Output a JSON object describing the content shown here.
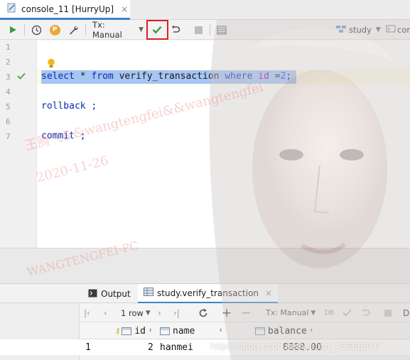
{
  "tab": {
    "title": "console_11 [HurryUp]",
    "close_icon": "×"
  },
  "toolbar": {
    "tx_mode": "Tx: Manual",
    "schema": "study",
    "console": "con",
    "p_badge": "P"
  },
  "editor": {
    "line_numbers": [
      "1",
      "2",
      "3",
      "4",
      "5",
      "6",
      "7"
    ],
    "line3": {
      "kw_select": "select",
      "star": " * ",
      "kw_from": "from",
      "table": " verify_transaction ",
      "kw_where": "where",
      "sp": " ",
      "col": "id",
      "eq": " =",
      "val": "2",
      "semi": ";"
    },
    "line5": "rollback ;",
    "line7": "commit ;"
  },
  "watermark": {
    "line1": "王腾飞&&wangtengfei&&wangtengfei",
    "line2": "2020-11-26",
    "line3": "WANGTENGFEI-PC"
  },
  "results": {
    "tab_output": "Output",
    "tab_table": "study.verify_transaction",
    "rows_dropdown": "1 row",
    "tx_mode": "Tx: Manual",
    "columns": [
      "id",
      "name",
      "balance"
    ],
    "row": {
      "index": "1",
      "id": "2",
      "name": "hanmei",
      "balance": "8888.00"
    },
    "source_url": "https://blog.csdn.net/weixin_43668816"
  },
  "colors": {
    "accent": "#4083c9",
    "highlight_border": "#e02020",
    "keyword": "#0a2bb3",
    "selection": "#a6c5f3",
    "run_green": "#3d9a3d"
  }
}
